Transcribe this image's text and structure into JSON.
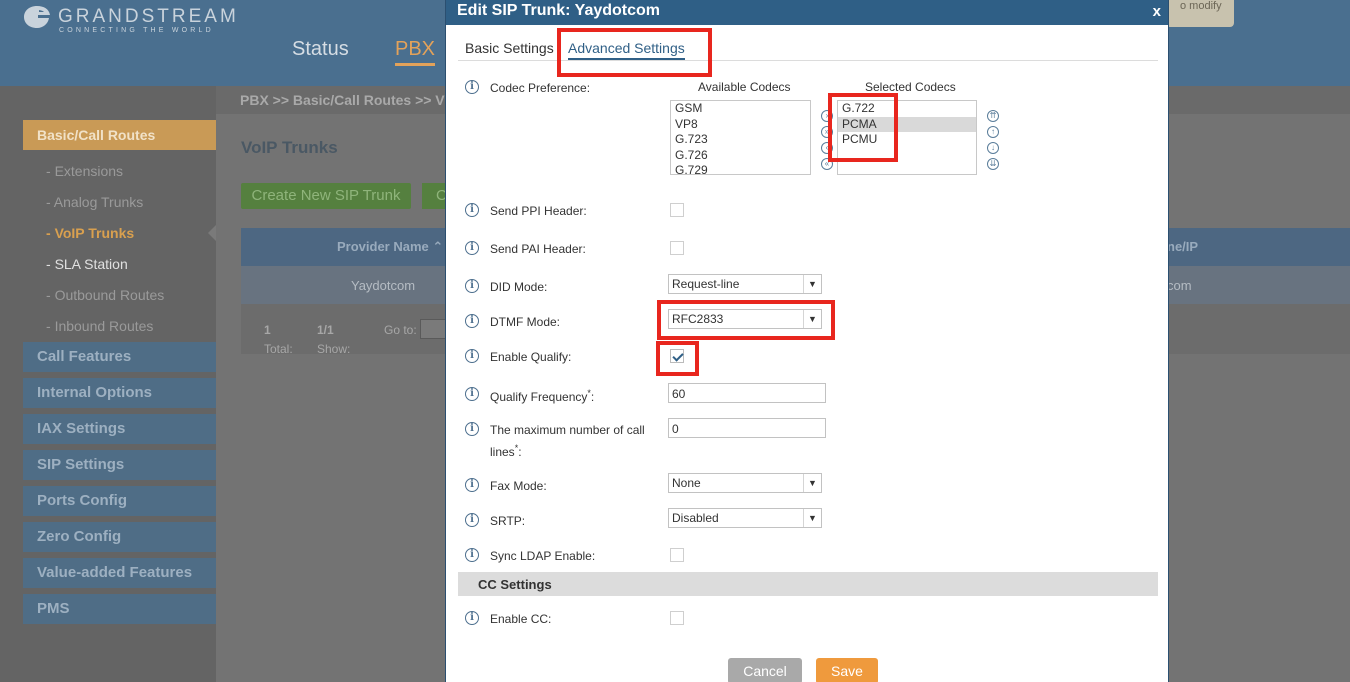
{
  "brand": {
    "name": "GRANDSTREAM",
    "tagline": "CONNECTING THE WORLD"
  },
  "top_nav": {
    "status": "Status",
    "pbx": "PBX"
  },
  "top_note": "o modify",
  "sidebar": {
    "active_section": "Basic/Call Routes",
    "sub_items": [
      {
        "label": "Extensions"
      },
      {
        "label": "Analog Trunks"
      },
      {
        "label": "VoIP Trunks"
      },
      {
        "label": "SLA Station"
      },
      {
        "label": "Outbound Routes"
      },
      {
        "label": "Inbound Routes"
      }
    ],
    "categories": [
      {
        "label": "Call Features"
      },
      {
        "label": "Internal Options"
      },
      {
        "label": "IAX Settings"
      },
      {
        "label": "SIP Settings"
      },
      {
        "label": "Ports Config"
      },
      {
        "label": "Zero Config"
      },
      {
        "label": "Value-added Features"
      },
      {
        "label": "PMS"
      }
    ]
  },
  "main": {
    "breadcrumb": "PBX >> Basic/Call Routes >> V",
    "title": "VoIP Trunks",
    "create_button": "Create New SIP Trunk",
    "create_button2": "C",
    "table": {
      "headers": {
        "provider": "Provider Name",
        "host": "ne/IP"
      },
      "row": {
        "provider": "Yaydotcom",
        "host": "com"
      },
      "footer": {
        "total_label": "Total:",
        "total": "1",
        "show_label": "Show:",
        "show": "1/1",
        "goto_label": "Go to:"
      }
    }
  },
  "modal": {
    "title": "Edit SIP Trunk: Yaydotcom",
    "close": "x",
    "tabs": {
      "basic": "Basic Settings",
      "advanced": "Advanced Settings"
    },
    "info_glyph": "i",
    "codec": {
      "label": "Codec Preference:",
      "available_header": "Available Codecs",
      "selected_header": "Selected Codecs",
      "available": [
        "GSM",
        "VP8",
        "G.723",
        "G.726",
        "G.729"
      ],
      "selected": [
        "G.722",
        "PCMA",
        "PCMU"
      ]
    },
    "fields": {
      "send_ppi": {
        "label": "Send PPI Header:",
        "checked": false
      },
      "send_pai": {
        "label": "Send PAI Header:",
        "checked": false
      },
      "did_mode": {
        "label": "DID Mode:",
        "value": "Request-line"
      },
      "dtmf_mode": {
        "label": "DTMF Mode:",
        "value": "RFC2833"
      },
      "enable_qualify": {
        "label": "Enable Qualify:",
        "checked": true
      },
      "qualify_frequency": {
        "label": "Qualify Frequency",
        "required": "*",
        "suffix": ":",
        "value": "60"
      },
      "max_call_lines": {
        "label_line1": "The maximum number of call",
        "label_line2": "lines",
        "required": "*",
        "suffix": ":",
        "value": "0"
      },
      "fax_mode": {
        "label": "Fax Mode:",
        "value": "None"
      },
      "srtp": {
        "label": "SRTP:",
        "value": "Disabled"
      },
      "sync_ldap": {
        "label": "Sync LDAP Enable:",
        "checked": false
      }
    },
    "cc_section": {
      "title": "CC Settings",
      "enable_cc": {
        "label": "Enable CC:",
        "checked": false
      }
    },
    "buttons": {
      "cancel": "Cancel",
      "save": "Save"
    }
  },
  "colors": {
    "modal_header": "#2f5f86",
    "save": "#ef9a3d",
    "cancel": "#a9a9a9",
    "highlight": "#e8261e",
    "sidebar_active": "#c99a56"
  }
}
